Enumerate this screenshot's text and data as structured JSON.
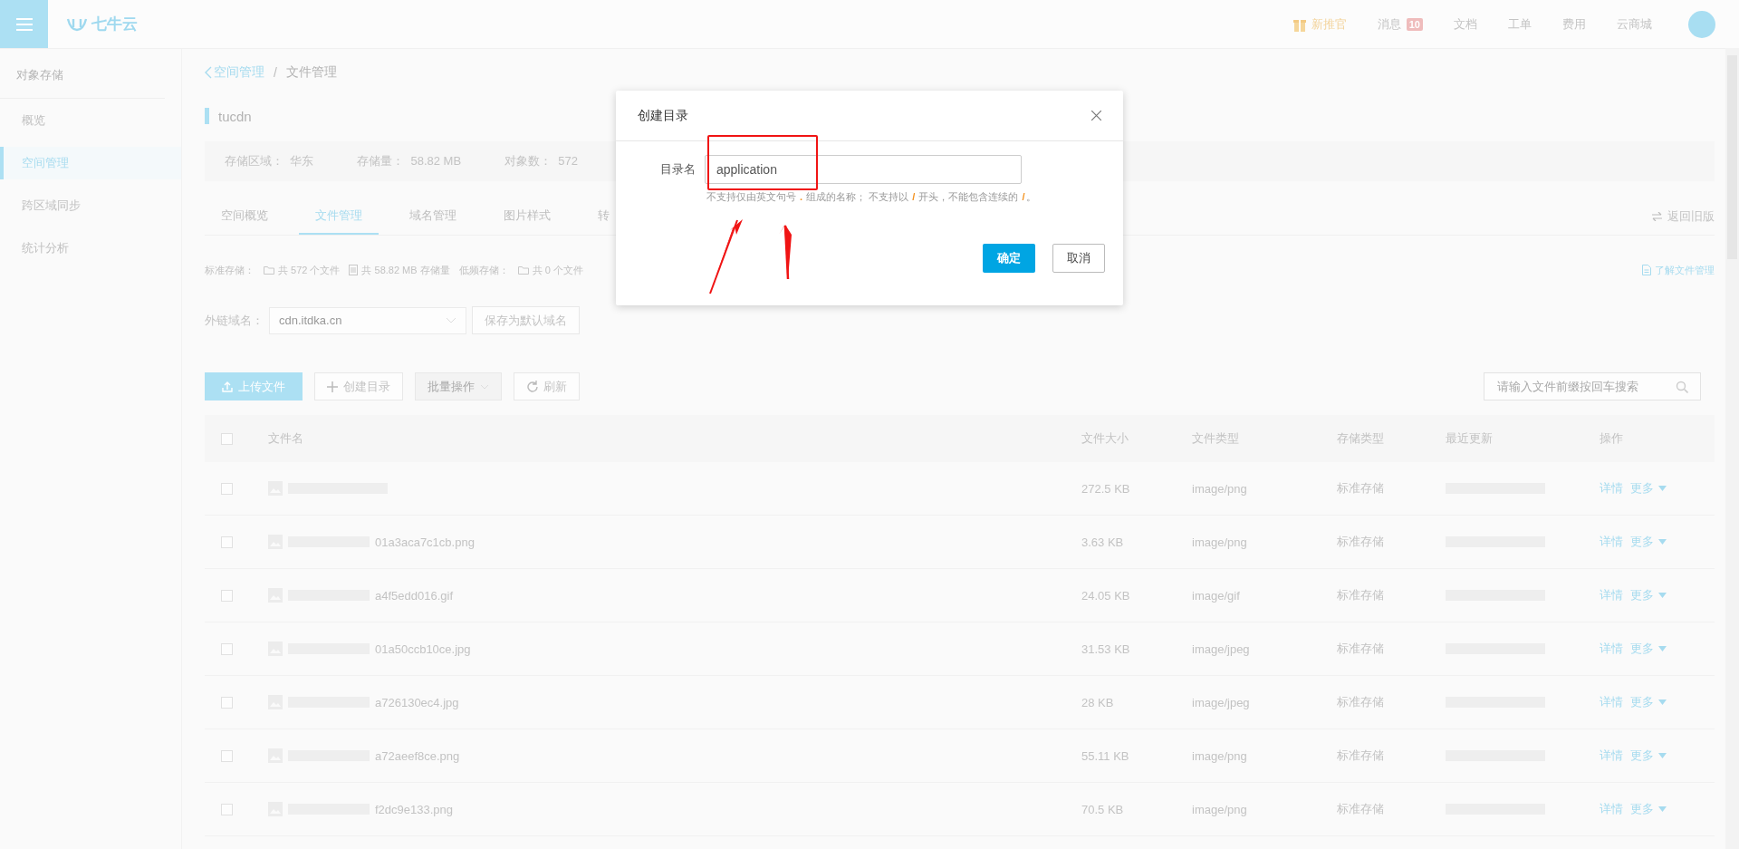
{
  "topbar": {
    "logo": "七牛云",
    "links": [
      {
        "label": "新推官",
        "kind": "promo"
      },
      {
        "label": "消息",
        "kind": "message",
        "badge": "10"
      },
      {
        "label": "文档",
        "kind": "plain"
      },
      {
        "label": "工单",
        "kind": "plain"
      },
      {
        "label": "费用",
        "kind": "plain"
      },
      {
        "label": "云商城",
        "kind": "plain"
      }
    ]
  },
  "sidebar": {
    "title": "对象存储",
    "items": [
      {
        "label": "概览",
        "selected": false
      },
      {
        "label": "空间管理",
        "selected": true
      },
      {
        "label": "跨区域同步",
        "selected": false
      },
      {
        "label": "统计分析",
        "selected": false
      }
    ]
  },
  "breadcrumb": {
    "parent": "空间管理",
    "separator": "/",
    "current": "文件管理"
  },
  "bucket": {
    "name": "tucdn",
    "info": [
      {
        "label": "存储区域：",
        "value": "华东"
      },
      {
        "label": "存储量：",
        "value": "58.82 MB"
      },
      {
        "label": "对象数：",
        "value": "572"
      }
    ]
  },
  "tabs": [
    {
      "label": "空间概览",
      "selected": false
    },
    {
      "label": "文件管理",
      "selected": true
    },
    {
      "label": "域名管理",
      "selected": false
    },
    {
      "label": "图片样式",
      "selected": false
    },
    {
      "label": "转",
      "selected": false
    }
  ],
  "old_version_link": "返回旧版",
  "stats": [
    {
      "kind": "label",
      "text": "标准存储："
    },
    {
      "kind": "folder",
      "text": "共 572 个文件"
    },
    {
      "kind": "storage",
      "text": "共 58.82 MB 存储量"
    },
    {
      "kind": "label",
      "text": "低频存储："
    },
    {
      "kind": "folder",
      "text": "共 0 个文件"
    }
  ],
  "help_link": "了解文件管理",
  "domain": {
    "label": "外链域名：",
    "value": "cdn.itdka.cn",
    "save_button": "保存为默认域名"
  },
  "toolbar": {
    "buttons": [
      {
        "label": "上传文件",
        "kind": "upload",
        "disabled": false
      },
      {
        "label": "创建目录",
        "kind": "add",
        "disabled": false
      },
      {
        "label": "批量操作",
        "kind": "dropdown",
        "disabled": true
      },
      {
        "label": "刷新",
        "kind": "refresh",
        "disabled": false
      }
    ],
    "search": {
      "placeholder": "请输入文件前缀按回车搜索"
    }
  },
  "table": {
    "select_all_checked": false,
    "columns": [
      "文件名",
      "文件大小",
      "文件类型",
      "存储类型",
      "最近更新",
      "操作"
    ],
    "rows": [
      {
        "checked": false,
        "name": "",
        "size": "272.5 KB",
        "type": "image/png",
        "storage": "标准存储",
        "actions": [
          "详情",
          "更多"
        ]
      },
      {
        "checked": false,
        "name": "01a3aca7c1cb.png",
        "size": "3.63 KB",
        "type": "image/png",
        "storage": "标准存储",
        "actions": [
          "详情",
          "更多"
        ]
      },
      {
        "checked": false,
        "name": "a4f5edd016.gif",
        "size": "24.05 KB",
        "type": "image/gif",
        "storage": "标准存储",
        "actions": [
          "详情",
          "更多"
        ]
      },
      {
        "checked": false,
        "name": "01a50ccb10ce.jpg",
        "size": "31.53 KB",
        "type": "image/jpeg",
        "storage": "标准存储",
        "actions": [
          "详情",
          "更多"
        ]
      },
      {
        "checked": false,
        "name": "a726130ec4.jpg",
        "size": "28 KB",
        "type": "image/jpeg",
        "storage": "标准存储",
        "actions": [
          "详情",
          "更多"
        ]
      },
      {
        "checked": false,
        "name": "a72aeef8ce.png",
        "size": "55.11 KB",
        "type": "image/png",
        "storage": "标准存储",
        "actions": [
          "详情",
          "更多"
        ]
      },
      {
        "checked": false,
        "name": "f2dc9e133.png",
        "size": "70.5 KB",
        "type": "image/png",
        "storage": "标准存储",
        "actions": [
          "详情",
          "更多"
        ]
      }
    ]
  },
  "dialog": {
    "title": "创建目录",
    "field_label": "目录名",
    "value": "application",
    "hint": [
      {
        "text": "不支持仅由英文句号 ",
        "highlight": false
      },
      {
        "text": ".",
        "highlight": true
      },
      {
        "text": " 组成的名称； 不支持以 ",
        "highlight": false
      },
      {
        "text": "/",
        "highlight": true
      },
      {
        "text": " 开头，不能包含连续的 ",
        "highlight": false
      },
      {
        "text": "/",
        "highlight": true
      },
      {
        "text": "。",
        "highlight": false
      }
    ],
    "confirm": "确定",
    "cancel": "取消"
  }
}
